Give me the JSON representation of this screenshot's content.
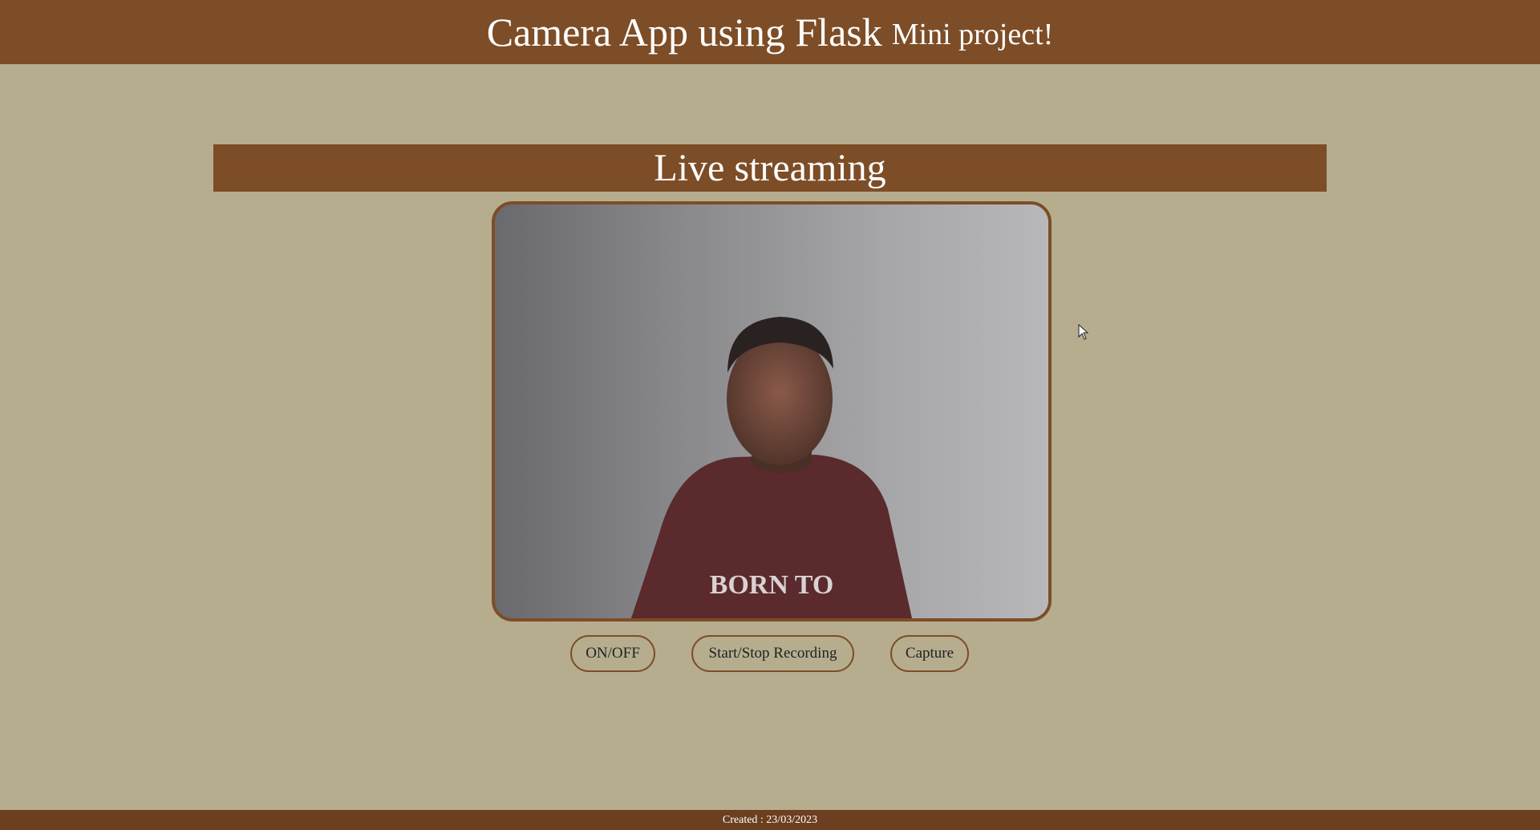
{
  "header": {
    "title_main": "Camera App using Flask",
    "title_sub": "Mini project!"
  },
  "section": {
    "title": "Live streaming"
  },
  "video": {
    "feed_label": "BORN TO"
  },
  "controls": {
    "onoff_label": "ON/OFF",
    "record_label": "Start/Stop Recording",
    "capture_label": "Capture"
  },
  "footer": {
    "created_text": "Created : 23/03/2023"
  },
  "colors": {
    "background": "#b6ad8f",
    "accent": "#7d4d27",
    "footer": "#6b3f1f"
  },
  "icons": {
    "cursor": "mouse-pointer-icon"
  }
}
